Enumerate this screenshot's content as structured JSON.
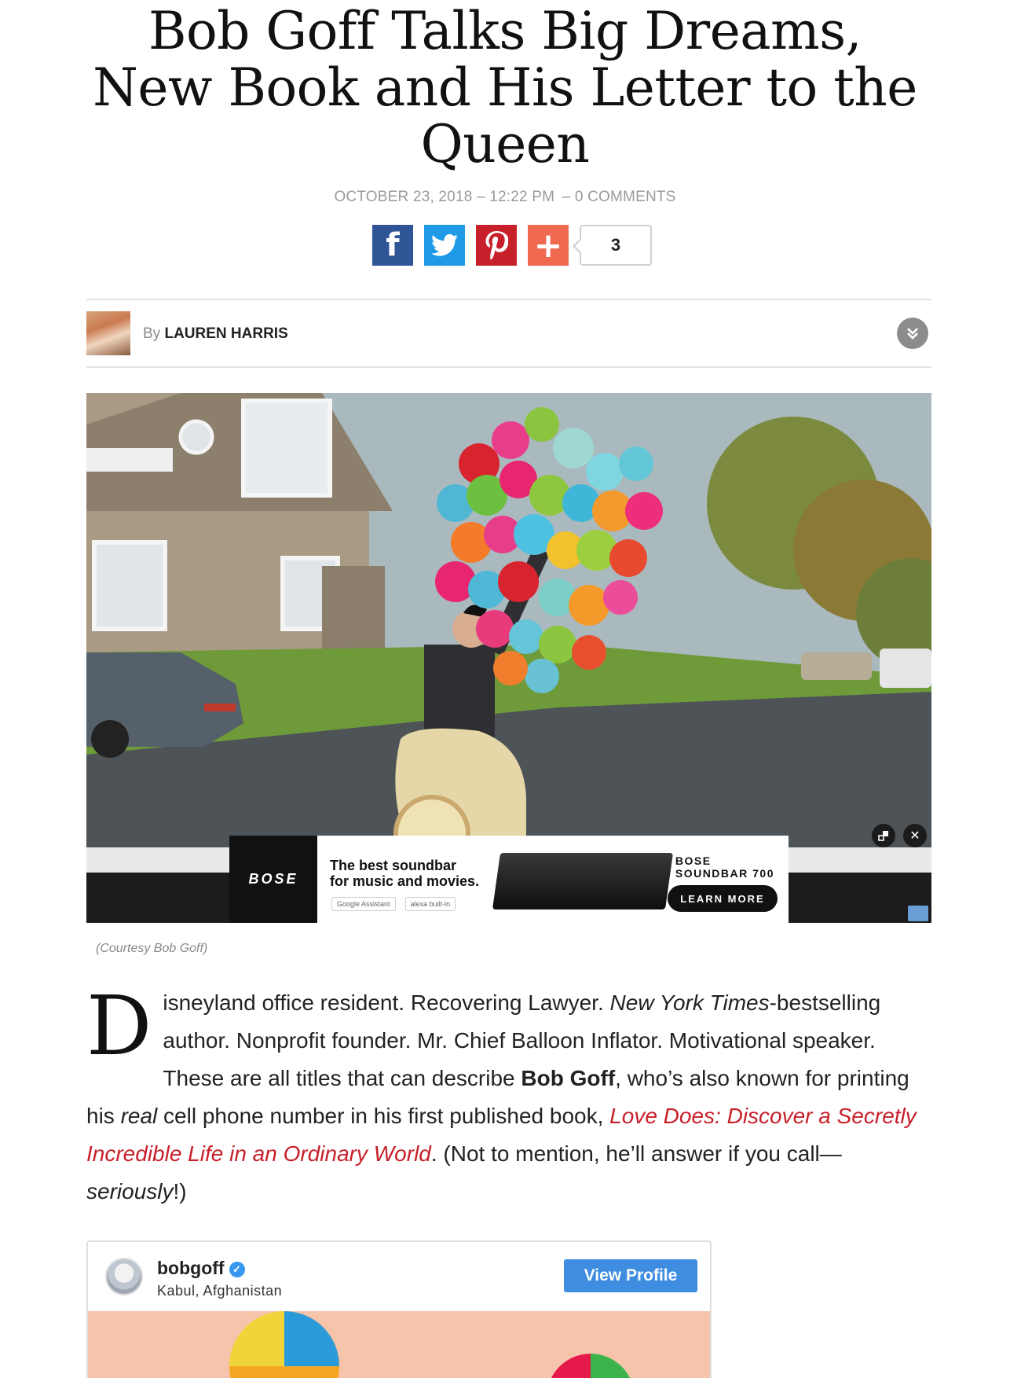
{
  "article": {
    "title": "Bob Goff Talks Big Dreams, New Book and His Letter to the Queen",
    "date": "OCTOBER 23, 2018 – 12:22 PM",
    "comments": "– 0 COMMENTS",
    "share_count": "3",
    "byline_prefix": "By",
    "author": "LAUREN HARRIS",
    "caption": "(Courtesy Bob Goff)",
    "dropcap": "D",
    "p1_a": "isneyland office resident. Recovering Lawyer. ",
    "p1_nyt": "New York Times",
    "p1_b": "-bestselling author. Nonprofit founder. Mr. Chief Balloon Inflator. Motivational speaker. These are all titles that can describe ",
    "p1_name": "Bob Goff",
    "p1_c": ", who’s also known for printing his ",
    "p1_real": "real",
    "p1_d": " cell phone number in his first published book, ",
    "p1_book": "Love Does: Discover a Secretly Incredible Life in an Ordinary World",
    "p1_e": ". (Not to mention, he’ll answer if you call—",
    "p1_seriously": "seriously",
    "p1_f": "!)"
  },
  "share": {
    "facebook_glyph": "f",
    "plus_glyph": "+"
  },
  "ad": {
    "brand": "BOSE",
    "copy_line1": "The best soundbar",
    "copy_line2": "for music and movies.",
    "chip1": "Google Assistant",
    "chip2": "alexa built-in",
    "product_line1": "BOSE",
    "product_line2": "SOUNDBAR 700",
    "cta": "LEARN MORE",
    "close_glyph": "✕"
  },
  "instagram": {
    "username": "bobgoff",
    "location": "Kabul, Afghanistan",
    "button": "View Profile",
    "verified_glyph": "✓"
  },
  "colors": {
    "facebook": "#2f5597",
    "twitter": "#1e9ae6",
    "pinterest": "#c8202a",
    "plus": "#ef6a51",
    "link": "#c8202a",
    "instagram_button": "#3e8de1"
  }
}
